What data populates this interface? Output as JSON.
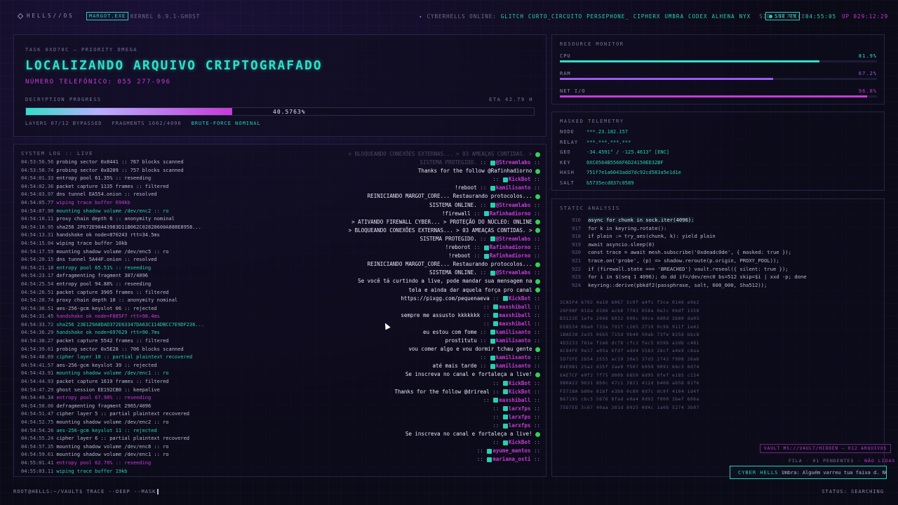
{
  "topbar": {
    "brand": "HELLS//OS",
    "tag": "MARGOT.EXE",
    "kernel": "KERNEL 6.9.1-GHOST",
    "online_label": "CYBERHELLS ONLINE:",
    "online_users": [
      "GLITCH",
      "CURTO_CIRCUITO",
      "PERSEPHONE_",
      "CIPHERX",
      "UMBRA",
      "CODEX",
      "ALHENA",
      "NYX"
    ],
    "sid": "SID 53C7CECE",
    "snd": "SND ON",
    "clock": "04:55:05",
    "uptime": "UP 029:12:29"
  },
  "task": {
    "label": "TASK 0XD70C — PRIORITY OMEGA",
    "title": "LOCALIZANDO ARQUIVO CRIPTOGRAFADO",
    "phone": "NÚMERO TELEFÔNICO: 055 277-996",
    "progress_label": "DECRYPTION PROGRESS",
    "eta": "ETA 42.79 H",
    "progress_text": "40.5763%",
    "progress_value": 0.405763,
    "layers": "LAYERS 07/12 BYPASSED",
    "fragments": "FRAGMENTS 1662/4096",
    "bruteforce": "BRUTE-FORCE NOMINAL"
  },
  "log": {
    "label": "SYSTEM LOG :: LIVE",
    "lines": [
      {
        "ts": "04:53:56.56",
        "msg": "probing sector 0x8441 :: 767 blocks scanned",
        "c": "norm"
      },
      {
        "ts": "04:53:58.74",
        "msg": "probing sector 0x8209 :: 757 blocks scanned",
        "c": "norm"
      },
      {
        "ts": "04:54:01.33",
        "msg": "entropy pool 61.35% :: reseeding",
        "c": "norm"
      },
      {
        "ts": "04:54:02.36",
        "msg": "packet capture 1135 frames :: filtered",
        "c": "norm"
      },
      {
        "ts": "04:54:03.97",
        "msg": "dns tunnel EA554.onion :: resolved",
        "c": "norm"
      },
      {
        "ts": "04:54:05.77",
        "msg": "wiping trace buffer 694kb",
        "c": "mag"
      },
      {
        "ts": "04:54:07.90",
        "msg": "mounting shadow volume /dev/enc2 :: ro",
        "c": "cyan"
      },
      {
        "ts": "04:54:10.11",
        "msg": "proxy chain depth 6 :: anonymity nominal",
        "c": "norm"
      },
      {
        "ts": "04:54:10.95",
        "msg": "sha256 2F672E90443983D11B062C02828600A888E8958...",
        "c": "norm"
      },
      {
        "ts": "04:54:13.31",
        "msg": "handshake ok node=870243 rtt=34.5ms",
        "c": "norm"
      },
      {
        "ts": "04:54:15.04",
        "msg": "wiping trace buffer 10kb",
        "c": "norm"
      },
      {
        "ts": "04:54:17.59",
        "msg": "mounting shadow volume /dev/enc5 :: ro",
        "c": "norm"
      },
      {
        "ts": "04:54:20.15",
        "msg": "dns tunnel 5A44F.onion :: resolved",
        "c": "norm"
      },
      {
        "ts": "04:54:21.18",
        "msg": "entropy pool 65.51% :: reseeding",
        "c": "cyan"
      },
      {
        "ts": "04:54:23.17",
        "msg": "defragmenting fragment 307/4096",
        "c": "norm"
      },
      {
        "ts": "04:54:25.54",
        "msg": "entropy pool 94.88% :: reseeding",
        "c": "norm"
      },
      {
        "ts": "04:54:26.51",
        "msg": "packet capture 3905 frames :: filtered",
        "c": "norm"
      },
      {
        "ts": "04:54:28.74",
        "msg": "proxy chain depth 10 :: anonymity nominal",
        "c": "norm"
      },
      {
        "ts": "04:54:30.51",
        "msg": "aes-256-gcm keyslot 06 :: rejected",
        "c": "norm"
      },
      {
        "ts": "04:54:31.45",
        "msg": "handshake ok node=F885F7 rtt=98.4ms",
        "c": "mag"
      },
      {
        "ts": "04:54:33.72",
        "msg": "sha256 23E129A8DAD372E63347DA63C114DBCC7E9DF236...",
        "c": "cyan"
      },
      {
        "ts": "04:54:36.29",
        "msg": "handshake ok node=697629 rtt=90.7ms",
        "c": "cyan"
      },
      {
        "ts": "04:54:38.27",
        "msg": "packet capture 5542 frames :: filtered",
        "c": "norm"
      },
      {
        "ts": "04:54:39.61",
        "msg": "probing sector 0x5E28 :: 706 blocks scanned",
        "c": "norm"
      },
      {
        "ts": "04:54:40.69",
        "msg": "cipher layer 10 :: partial plaintext recovered",
        "c": "cyan"
      },
      {
        "ts": "04:54:41.57",
        "msg": "aes-256-gcm keyslot 39 :: rejected",
        "c": "norm"
      },
      {
        "ts": "04:54:43.91",
        "msg": "mounting shadow volume /dev/enc1 :: ro",
        "c": "cyan"
      },
      {
        "ts": "04:54:44.93",
        "msg": "packet capture 1619 frames :: filtered",
        "c": "norm"
      },
      {
        "ts": "04:54:47.29",
        "msg": "ghost session EE192CB0 :: keepalive",
        "c": "norm"
      },
      {
        "ts": "04:54:49.34",
        "msg": "entropy pool 67.98% :: reseeding",
        "c": "mag"
      },
      {
        "ts": "04:54:50.06",
        "msg": "defragmenting fragment 2965/4096",
        "c": "norm"
      },
      {
        "ts": "04:54:51.47",
        "msg": "cipher layer 5 :: partial plaintext recovered",
        "c": "norm"
      },
      {
        "ts": "04:54:52.75",
        "msg": "mounting shadow volume /dev/enc2 :: ro",
        "c": "norm"
      },
      {
        "ts": "04:54:54.26",
        "msg": "aes-256-gcm keyslot 11 :: rejected",
        "c": "cyan"
      },
      {
        "ts": "04:54:55.24",
        "msg": "cipher layer 6 :: partial plaintext recovered",
        "c": "norm"
      },
      {
        "ts": "04:54:57.35",
        "msg": "mounting shadow volume /dev/enc8 :: ro",
        "c": "norm"
      },
      {
        "ts": "04:54:59.61",
        "msg": "mounting shadow volume /dev/enc1 :: ro",
        "c": "norm"
      },
      {
        "ts": "04:55:01.41",
        "msg": "entropy pool 62.76% :: reseeding",
        "c": "mag"
      },
      {
        "ts": "04:55:03.11",
        "msg": "wiping trace buffer 19kb",
        "c": "cyan"
      }
    ]
  },
  "chat": [
    {
      "text": "> BLOQUEANDO CONEXÕES EXTERNAS... > 03 AMEAÇAS CONTIDAS. >",
      "faded": true
    },
    {
      "text": "SISTEMA PROTEGIDO.",
      "user": "@Streamlabs",
      "faded": true
    },
    {
      "text": "Thanks for the follow @Rafinhadiorno",
      "user": ""
    },
    {
      "text": "",
      "user": "KickBot"
    },
    {
      "text": "!reboot",
      "user": "kamilisanto"
    },
    {
      "text": "REINICIANDO MARGOT_CORE... Restaurando protocolos...",
      "user": ""
    },
    {
      "text": "SISTEMA ONLINE.",
      "user": "@Streamlabs"
    },
    {
      "text": "!firewall",
      "user": "Rafinhadiorno"
    },
    {
      "text": "> ATIVANDO FIREWALL CYBER... > PROTEÇÃO DO NÚCLEO: ONLINE",
      "user": ""
    },
    {
      "text": "> BLOQUEANDO CONEXÕES EXTERNAS... > 03 AMEAÇAS CONTIDAS. >",
      "user": ""
    },
    {
      "text": "SISTEMA PROTEGIDO.",
      "user": "@Streamlabs"
    },
    {
      "text": "!reborot",
      "user": "Rafinhadiorno"
    },
    {
      "text": "!reboot",
      "user": "Rafinhadiorno"
    },
    {
      "text": "REINICIANDO MARGOT_CORE... Restaurando protocolos...",
      "user": ""
    },
    {
      "text": "SISTEMA ONLINE.",
      "user": "@Streamlabs"
    },
    {
      "text": "Se você tá curtindo a live, pode mandar sua mensagem na",
      "user": ""
    },
    {
      "text": "tela e ainda dar aquela força pro canal",
      "user": ""
    },
    {
      "text": "https://pixgg.com/pequenaeva",
      "user": "KickBot"
    },
    {
      "text": "",
      "user": "maxshiball"
    },
    {
      "text": "sempre me assusto kkkkkkk",
      "user": "maxshiball"
    },
    {
      "text": "",
      "user": "maxshiball"
    },
    {
      "text": "eu estou com fome",
      "user": "kamilisanto"
    },
    {
      "text": "prostitutu",
      "user": "kamilisanto"
    },
    {
      "text": "vou comer algo e vou dormir tchau gente",
      "user": ""
    },
    {
      "text": "",
      "user": "kamilisanto"
    },
    {
      "text": "até mais tarde",
      "user": "kamilisanto"
    },
    {
      "text": "Se inscreva no canal e fortaleça a live!",
      "user": ""
    },
    {
      "text": "",
      "user": "KickBot"
    },
    {
      "text": "Thanks for the follow @drireal",
      "user": "KickBot"
    },
    {
      "text": "",
      "user": "maxshiball"
    },
    {
      "text": "",
      "user": "larxfps"
    },
    {
      "text": "",
      "user": "larxfps"
    },
    {
      "text": "",
      "user": "larxfps"
    },
    {
      "text": "Se inscreva no canal e fortaleça a live!",
      "user": ""
    },
    {
      "text": "",
      "user": "KickBot"
    },
    {
      "text": "",
      "user": "ayume_mantos"
    },
    {
      "text": "",
      "user": "mariana_osti"
    }
  ],
  "resources": {
    "label": "RESOURCE MONITOR",
    "items": [
      {
        "name": "CPU",
        "value_text": "81.9%",
        "value": 0.819,
        "color": "#2ee0c8"
      },
      {
        "name": "RAM",
        "value_text": "67.2%",
        "value": 0.672,
        "color": "#9a5cf0"
      },
      {
        "name": "NET I/O",
        "value_text": "96.8%",
        "value": 0.968,
        "color": "#c83ad8"
      }
    ]
  },
  "telemetry": {
    "label": "MASKED TELEMETRY",
    "rows": [
      {
        "k": "NODE",
        "v": "***.23.182.157"
      },
      {
        "k": "RELAY",
        "v": "***.***.***.***"
      },
      {
        "k": "GEO",
        "v": "-34.4591° / -125.4613° [ENC]"
      },
      {
        "k": "KEY",
        "v": "0XC0564B5566F6D24150ED32BF"
      },
      {
        "k": "HASH",
        "v": "751f7e1a6043add7dc92cd583a5e1d1e"
      },
      {
        "k": "SALT",
        "v": "b5735ecd837c0589"
      }
    ]
  },
  "analysis": {
    "label": "STATIC ANALYSIS",
    "code": [
      {
        "n": "916",
        "t": "async for chunk in sock.iter(4096):"
      },
      {
        "n": "917",
        "t": "for k in keyring.rotate():"
      },
      {
        "n": "918",
        "t": "if plain := try_aes(chunk, k): yield plain"
      },
      {
        "n": "919",
        "t": "await asyncio.sleep(0)"
      },
      {
        "n": "920",
        "t": "const trace = await mesh.subscribe('0xdeadc0de', { masked: true });"
      },
      {
        "n": "921",
        "t": "trace.on('probe', (p) => shadow.reroute(p.origin, PROXY_POOL));"
      },
      {
        "n": "922",
        "t": "if (firewall.state === 'BREACHED') vault.reseal({ silent: true });"
      },
      {
        "n": "923",
        "t": "for i in $(seq 1 4096); do dd if=/dev/enc0 bs=512 skip=$i | xxd -p; done"
      },
      {
        "n": "924",
        "t": "keyring::derive(pbkdf2(passphrase, salt, 600_000, Sha512));"
      }
    ],
    "hex": [
      "3CA5F4 6702 4a10 b067 5c9f a4fc f3ce 0146 e9e2",
      "26F0BF 61da d286 acb6 7783 658a 0e2c 0bdf 1358",
      "B3123E 1efe 2046 b032 099c 90ce 0d0d 3b80 da03",
      "D58534 06a0 733a 791f c265 2f19 0c9b 911f 1e42",
      "1BAE38 2e35 06b5 715d 9b40 50ab 73fe 8256 bbc8",
      "4D3233 761e f2e6 dc78 cfc2 fec5 659b a2db c481",
      "AC84FE 9e17 a05a 6fdf add4 5583 28cf a4e9 c8aa",
      "5D75FE 2b54 2555 ac19 30e5 37d3 2743 f998 26ab",
      "84E9B1 25a2 d35f 2ae0 f507 b059 9091 68c3 0d74",
      "6AE7CF e0f2 7f75 d00b 6850 6d95 8fef e185 c134",
      "9B0A22 9631 8b0c 47c1 3821 412d b408 ab58 81f6",
      "F5718A b80e 81bf e3b8 0c80 0d7c dc9f 4104 1d4f",
      "B67195 cbc5 5676 8fad e0a4 0d92 f000 3bef 606a",
      "75D7ED 3c67 40aa 381d 8925 0d4c 1a0b 5274 3b97"
    ]
  },
  "vault": "VAULT MS://VAULT/HIDDEN — 012 ARQUIVOS",
  "fila": {
    "text": "FILA · 01 PENDENTES ·",
    "warn": "NÃO LIDAS"
  },
  "toast": {
    "title": "CYBER HELLS",
    "message": "Umbra: Alguém varreu tua faixa d. NOVO"
  },
  "cmd": "ROOT@HELLS:~/VAULT$ TRACE --DEEP --MASK",
  "status": "STATUS: SEARCHING",
  "colors": {
    "accent": "#2ee0c8",
    "magenta": "#c83ad8",
    "bg": "#0b0a17"
  }
}
